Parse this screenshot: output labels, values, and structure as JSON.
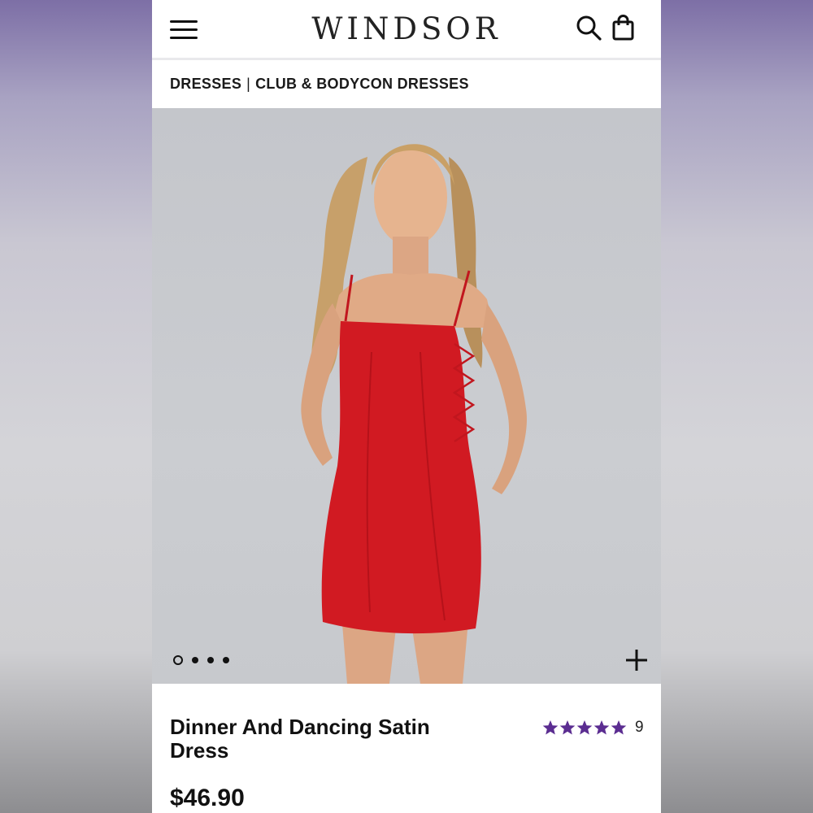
{
  "header": {
    "logo": "WINDSOR",
    "menu_icon": "hamburger-menu-icon",
    "search_icon": "search-icon",
    "bag_icon": "shopping-bag-icon"
  },
  "breadcrumb": {
    "items": [
      "DRESSES",
      "CLUB & BODYCON DRESSES"
    ],
    "separator": "|"
  },
  "gallery": {
    "image_count": 4,
    "active_index": 0,
    "zoom_icon": "plus-icon"
  },
  "product": {
    "title": "Dinner And Dancing Satin Dress",
    "price": "$46.90",
    "rating": 5,
    "review_count": "9",
    "star_color": "#5b2d91"
  },
  "colors": {
    "dress": "#d11a22",
    "background": "#c7c9cd"
  }
}
